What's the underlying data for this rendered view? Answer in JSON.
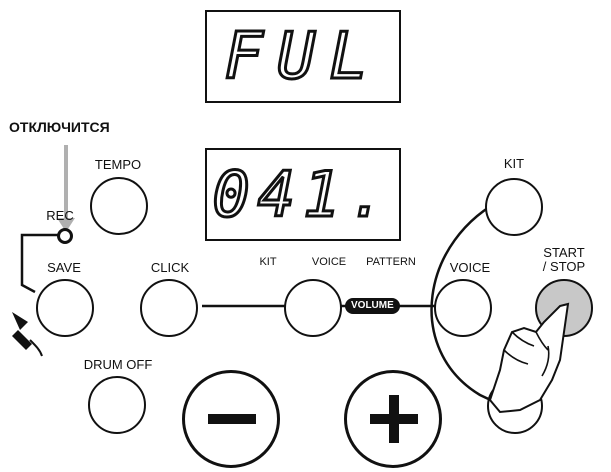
{
  "displays": {
    "top": "FUL",
    "bottom": "041."
  },
  "labels": {
    "off_notice": "ОТКЛЮЧИТСЯ",
    "tempo": "TEMPO",
    "rec": "REC",
    "save": "SAVE",
    "click": "CLICK",
    "kit_small": "KIT",
    "voice_small": "VOICE",
    "pattern_small": "PATTERN",
    "kit": "KIT",
    "voice": "VOICE",
    "start_stop_line1": "START",
    "start_stop_line2": "/ STOP",
    "drum_off": "DRUM OFF",
    "volume": "VOLUME",
    "minus": "−",
    "plus": "+"
  },
  "icons": {
    "hand": "pointing-hand-icon",
    "pen": "pen-icon",
    "arrow": "arrow-down-icon"
  },
  "colors": {
    "pressed": "#c8c8c8",
    "arrow": "#b0b0b0"
  }
}
